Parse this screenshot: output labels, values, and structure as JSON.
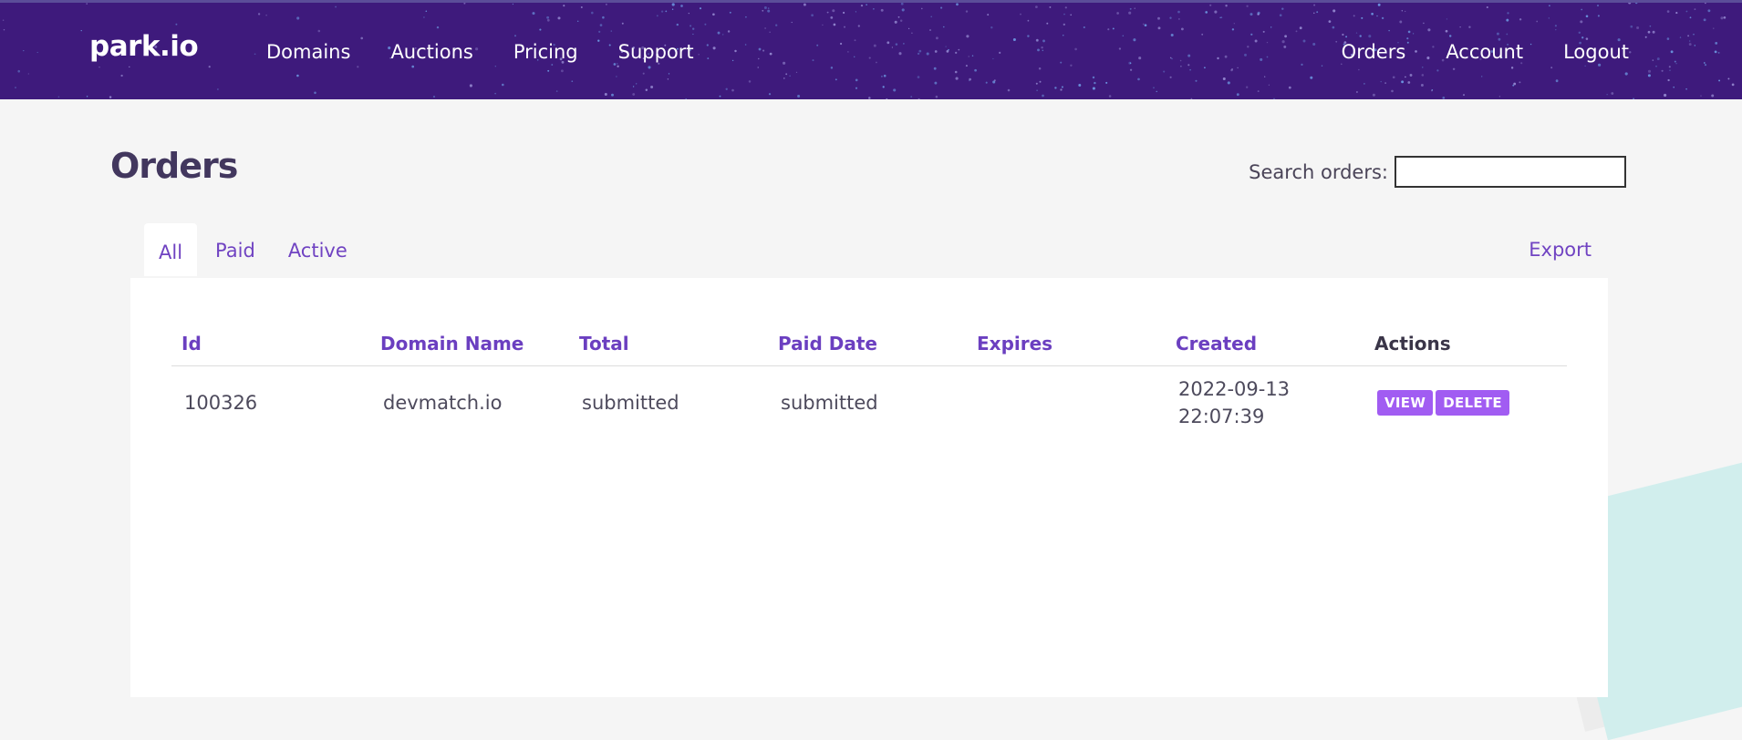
{
  "header": {
    "logo": "park.io",
    "nav_left": [
      "Domains",
      "Auctions",
      "Pricing",
      "Support"
    ],
    "nav_right": [
      "Orders",
      "Account",
      "Logout"
    ]
  },
  "page": {
    "title": "Orders",
    "search_label": "Search orders:",
    "search_value": ""
  },
  "tabs": {
    "items": [
      "All",
      "Paid",
      "Active"
    ],
    "active": "All",
    "export": "Export"
  },
  "table": {
    "headers": [
      "Id",
      "Domain Name",
      "Total",
      "Paid Date",
      "Expires",
      "Created",
      "Actions"
    ],
    "rows": [
      {
        "id": "100326",
        "domain": "devmatch.io",
        "total": "submitted",
        "paid_date": "submitted",
        "expires": "",
        "created_date": "2022-09-13",
        "created_time": "22:07:39",
        "actions": [
          "VIEW",
          "DELETE"
        ]
      }
    ]
  },
  "colors": {
    "header_bg": "#3e1a7c",
    "accent": "#6f42c1",
    "button": "#a15cf2"
  }
}
